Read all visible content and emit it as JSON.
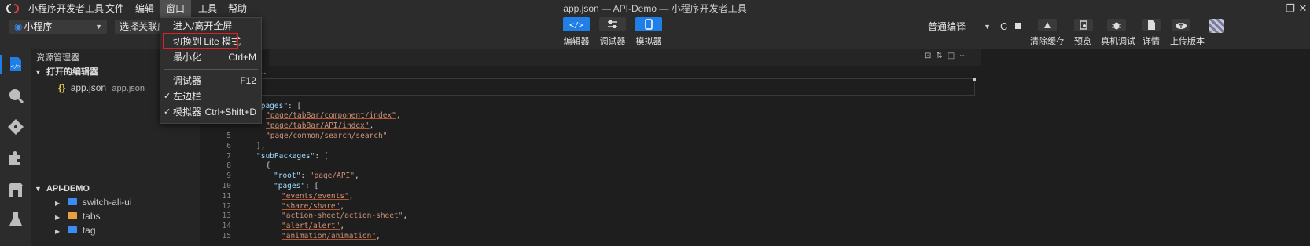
{
  "window": {
    "title": "app.json — API-Demo — 小程序开发者工具",
    "menus": [
      "小程序开发者工具",
      "文件",
      "编辑",
      "窗口",
      "工具",
      "帮助"
    ],
    "controls": [
      "—",
      "❐",
      "✕"
    ]
  },
  "toolbar": {
    "project_select": "小程序",
    "related_select": "选择关联应",
    "modes": [
      {
        "label": "编辑器",
        "icon": "code-icon"
      },
      {
        "label": "调试器",
        "icon": "sliders-icon"
      },
      {
        "label": "模拟器",
        "icon": "phone-icon"
      }
    ],
    "compile_mode": "普通编译",
    "actions": [
      {
        "label": "清除缓存",
        "icon": "broom-icon"
      },
      {
        "label": "预览",
        "icon": "preview-icon"
      },
      {
        "label": "真机调试",
        "icon": "bug-icon"
      },
      {
        "label": "详情",
        "icon": "document-icon"
      },
      {
        "label": "上传版本",
        "icon": "upload-icon"
      }
    ]
  },
  "dropdown": {
    "items": [
      {
        "label": "进入/离开全屏",
        "shortcut": "",
        "checked": false
      },
      {
        "label": "切换到 Lite 模式",
        "shortcut": "",
        "checked": false
      },
      {
        "label": "最小化",
        "shortcut": "Ctrl+M",
        "checked": false
      },
      {
        "label": "调试器",
        "shortcut": "F12",
        "checked": false
      },
      {
        "label": "左边栏",
        "shortcut": "",
        "checked": true
      },
      {
        "label": "模拟器",
        "shortcut": "Ctrl+Shift+D",
        "checked": true
      }
    ]
  },
  "sidebar": {
    "title": "资源管理器",
    "open_editors": {
      "header": "打开的编辑器",
      "files": [
        {
          "name": "app.json",
          "path": "app.json",
          "icon": "json-icon"
        }
      ]
    },
    "project": {
      "header": "API-DEMO",
      "items": [
        {
          "name": "switch-ali-ui",
          "icon": "folder-icon"
        },
        {
          "name": "tabs",
          "icon": "folder-icon"
        },
        {
          "name": "tag",
          "icon": "folder-icon"
        }
      ]
    }
  },
  "editor": {
    "breadcrumb": "...",
    "lines": [
      {
        "no": "",
        "text": ""
      },
      {
        "no": "",
        "text": ""
      },
      {
        "no": "",
        "text": "\"pages\": ["
      },
      {
        "no": "",
        "text": "\"page/tabBar/component/index\","
      },
      {
        "no": "",
        "text": "\"page/tabBar/API/index\","
      },
      {
        "no": "5",
        "text": "\"page/common/search/search\""
      },
      {
        "no": "6",
        "text": "],"
      },
      {
        "no": "7",
        "text": "\"subPackages\": ["
      },
      {
        "no": "8",
        "text": "{"
      },
      {
        "no": "9",
        "text": "\"root\": \"page/API\","
      },
      {
        "no": "10",
        "text": "\"pages\": ["
      },
      {
        "no": "11",
        "text": "\"events/events\","
      },
      {
        "no": "12",
        "text": "\"share/share\","
      },
      {
        "no": "13",
        "text": "\"action-sheet/action-sheet\","
      },
      {
        "no": "14",
        "text": "\"alert/alert\","
      },
      {
        "no": "15",
        "text": "\"animation/animation\","
      }
    ]
  }
}
